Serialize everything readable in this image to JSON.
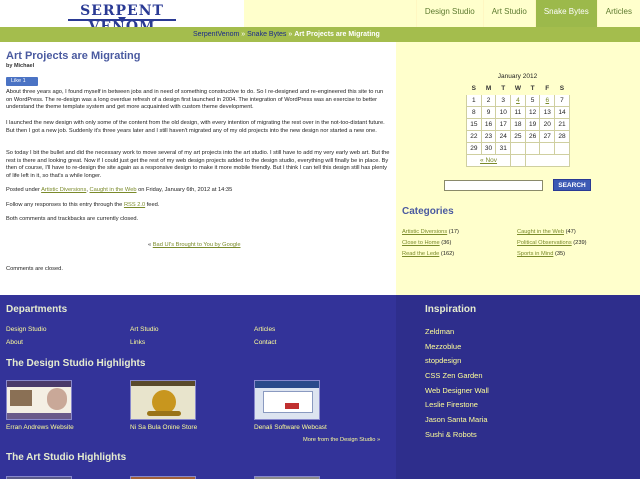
{
  "header": {
    "logo_text": "SERPENT VENOM",
    "nav": [
      {
        "label": "Design Studio",
        "active": false
      },
      {
        "label": "Art Studio",
        "active": false
      },
      {
        "label": "Snake Bytes",
        "active": true
      },
      {
        "label": "Articles",
        "active": false
      }
    ]
  },
  "breadcrumb": {
    "home": "SerpentVenom",
    "sep1": "»",
    "section": "Snake Bytes",
    "sep2": "»",
    "current": "Art Projects are Migrating"
  },
  "post": {
    "title": "Art Projects are Migrating",
    "author": "by Michael",
    "like_label": "Like 1",
    "p1": "About three years ago, I found myself in between jobs and in need of something constructive to do. So I re-designed and re-engineered this site to run on WordPress. The re-design was a long overdue refresh of a design first launched in 2004. The integration of WordPress was an exercise to better understand the theme template system and get more acquainted with custom theme development.",
    "p2": "I launched the new design with only some of the content from the old design, with every intention of migrating the rest over in the not-too-distant future. But then I got a new job. Suddenly it's three years later and I still haven't migrated any of my old projects into the new design nor started a new one.",
    "p3": "So today I bit the bullet and did the necessary work to move several of my art projects into the art studio. I still have to add my very early web art. But the rest is there and looking great. Now if I could just get the rest of my web design projects added to the design studio, everything will finally be in place. By then of course, I'll have to re-design the site again as a responsive design to make it more mobile friendly. But I think I can tell this design still has plenty of life left in it, so that's a while longer.",
    "posted_prefix": "Posted under",
    "posted_cat1": "Artistic Diversions",
    "posted_comma": ",",
    "posted_cat2": "Caught in the Web",
    "posted_suffix": "on Friday, January 6th, 2012 at 14:35",
    "follow_prefix": "Follow any responses to this entry through the",
    "follow_link": "RSS 2.0",
    "follow_suffix": "feed.",
    "trackbacks": "Both comments and trackbacks are currently closed.",
    "prev_symbol": "«",
    "prev_link": "Bad UI's Brought to You by Google",
    "comments_closed": "Comments are closed."
  },
  "calendar": {
    "caption": "January 2012",
    "days": [
      "S",
      "M",
      "T",
      "W",
      "T",
      "F",
      "S"
    ],
    "weeks": [
      [
        {
          "d": "1"
        },
        {
          "d": "2"
        },
        {
          "d": "3"
        },
        {
          "d": "4",
          "link": true
        },
        {
          "d": "5"
        },
        {
          "d": "6",
          "link": true
        },
        {
          "d": "7"
        }
      ],
      [
        {
          "d": "8"
        },
        {
          "d": "9"
        },
        {
          "d": "10"
        },
        {
          "d": "11"
        },
        {
          "d": "12"
        },
        {
          "d": "13"
        },
        {
          "d": "14"
        }
      ],
      [
        {
          "d": "15"
        },
        {
          "d": "16"
        },
        {
          "d": "17"
        },
        {
          "d": "18"
        },
        {
          "d": "19"
        },
        {
          "d": "20"
        },
        {
          "d": "21"
        }
      ],
      [
        {
          "d": "22"
        },
        {
          "d": "23"
        },
        {
          "d": "24"
        },
        {
          "d": "25"
        },
        {
          "d": "26"
        },
        {
          "d": "27"
        },
        {
          "d": "28"
        }
      ],
      [
        {
          "d": "29"
        },
        {
          "d": "30"
        },
        {
          "d": "31"
        },
        {
          "d": ""
        },
        {
          "d": ""
        },
        {
          "d": ""
        },
        {
          "d": ""
        }
      ]
    ],
    "prev": "« Nov"
  },
  "search": {
    "value": "",
    "button": "SEARCH"
  },
  "categories": {
    "title": "Categories",
    "col1": [
      {
        "name": "Artistic Diversions",
        "count": "(17)"
      },
      {
        "name": "Close to Home",
        "count": "(36)"
      },
      {
        "name": "Read the Lede",
        "count": "(162)"
      }
    ],
    "col2": [
      {
        "name": "Caught in the Web",
        "count": "(47)"
      },
      {
        "name": "Political Observations",
        "count": "(239)"
      },
      {
        "name": "Sports in Mind",
        "count": "(35)"
      }
    ]
  },
  "footer": {
    "departments_title": "Departments",
    "departments": [
      "Design Studio",
      "Art Studio",
      "Articles",
      "About",
      "Links",
      "Contact"
    ],
    "design_title": "The Design Studio Highlights",
    "design_items": [
      "Erran Andrews Website",
      "Ni Sa Bula Onine Store",
      "Denali Software Webcast"
    ],
    "more_link": "More from the Design Studio »",
    "art_title": "The Art Studio Highlights",
    "inspiration_title": "Inspiration",
    "inspiration": [
      "Zeldman",
      "Mezzoblue",
      "stopdesign",
      "CSS Zen Garden",
      "Web Designer Wall",
      "Leslie Firestone",
      "Jason Santa Maria",
      "Sushi & Robots"
    ]
  },
  "colors": {
    "accent_green": "#a4bd4d",
    "header_bg": "#ffffcc",
    "footer_bg": "#333399",
    "title_blue": "#4a5aa0",
    "link_olive": "#7a8a2a"
  }
}
